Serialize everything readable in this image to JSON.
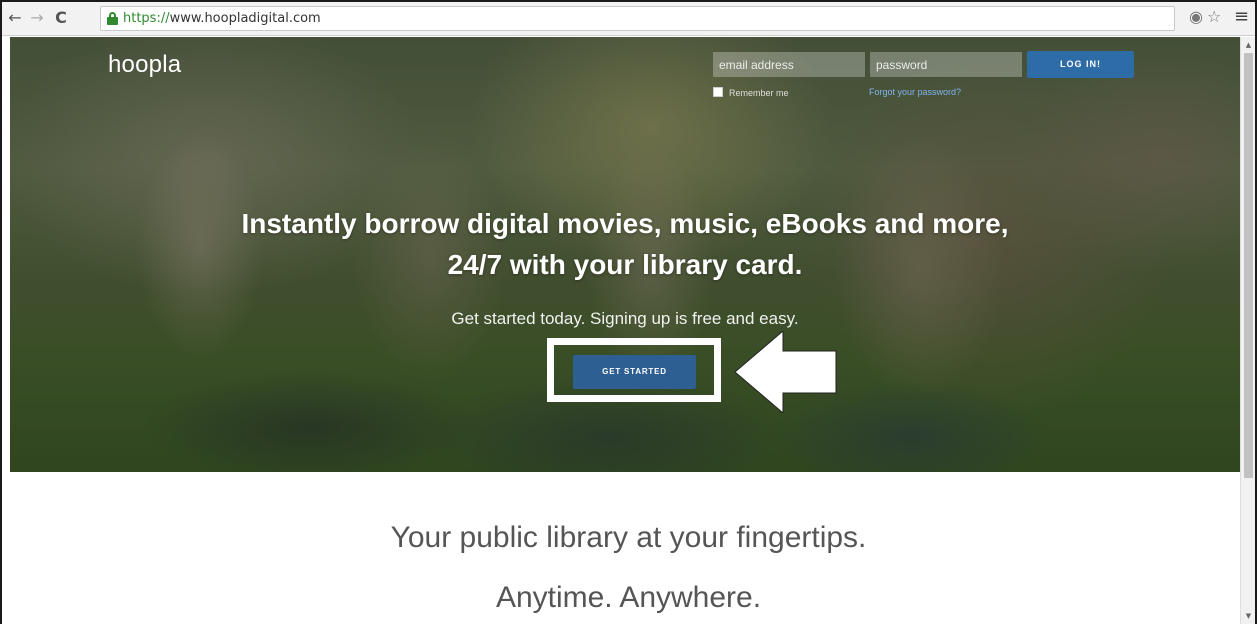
{
  "browser": {
    "back_icon": "←",
    "forward_icon": "→",
    "reload_icon": "C",
    "url_scheme": "https://",
    "url_host": "www.hoopladigital.com",
    "ext_icon": "◉",
    "star_icon": "☆",
    "menu_icon": "≡"
  },
  "header": {
    "logo": "hoopla",
    "email_placeholder": "email address",
    "password_placeholder": "password",
    "login_label": "LOG IN!",
    "remember_label": "Remember me",
    "forgot_label": "Forgot your password?"
  },
  "hero": {
    "headline_line1": "Instantly borrow digital movies, music, eBooks and more,",
    "headline_line2": "24/7 with your library card.",
    "subline": "Get started today. Signing up is free and easy.",
    "cta_label": "GET STARTED"
  },
  "body": {
    "tagline1": "Your public library at your fingertips.",
    "tagline2": "Anytime. Anywhere."
  },
  "colors": {
    "accent": "#2e6ca8",
    "cta": "#2e5f93",
    "link": "#7fb4ec"
  }
}
